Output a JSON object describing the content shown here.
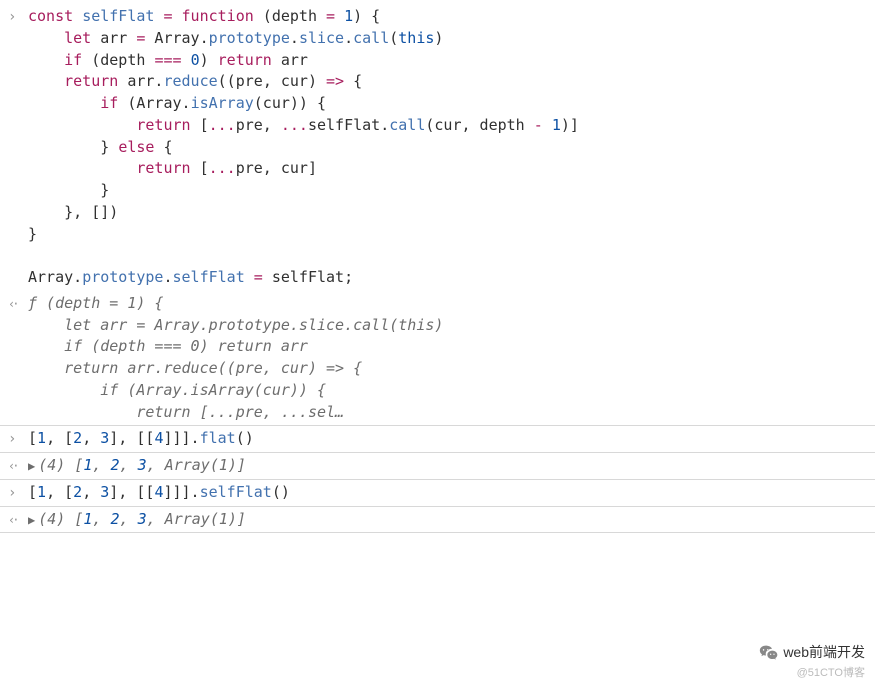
{
  "entries": [
    {
      "type": "input",
      "bordered": false,
      "html": "<span class='kw'>const</span> <span class='fn'>selfFlat</span> <span class='op'>=</span> <span class='kw'>function</span> (<span class='plain'>depth</span> <span class='op'>=</span> <span class='num'>1</span>) {\n    <span class='kw'>let</span> arr <span class='op'>=</span> Array.<span class='prop'>prototype</span>.<span class='prop'>slice</span>.<span class='fn'>call</span>(<span class='this'>this</span>)\n    <span class='kw'>if</span> (depth <span class='op'>===</span> <span class='num'>0</span>) <span class='kw'>return</span> arr\n    <span class='kw'>return</span> arr.<span class='fn'>reduce</span>((<span class='plain'>pre</span>, <span class='plain'>cur</span>) <span class='op'>=&gt;</span> {\n        <span class='kw'>if</span> (Array.<span class='fn'>isArray</span>(cur)) {\n            <span class='kw'>return</span> [<span class='op'>...</span>pre, <span class='op'>...</span>selfFlat.<span class='fn'>call</span>(cur, depth <span class='op'>-</span> <span class='num'>1</span>)]\n        } <span class='kw'>else</span> {\n            <span class='kw'>return</span> [<span class='op'>...</span>pre, cur]\n        }\n    }, [])\n}\n\nArray.<span class='prop'>prototype</span>.<span class='prop'>selfFlat</span> <span class='op'>=</span> selfFlat;"
    },
    {
      "type": "output",
      "bordered": true,
      "italic": true,
      "gray": true,
      "html": "ƒ (depth = 1) {\n    let arr = Array.prototype.slice.call(this)\n    if (depth === 0) return arr\n    return arr.reduce((pre, cur) =&gt; {\n        if (Array.isArray(cur)) {\n            return [...pre, ...sel…"
    },
    {
      "type": "input",
      "bordered": true,
      "html": "[<span class='num'>1</span>, [<span class='num'>2</span>, <span class='num'>3</span>], [[<span class='num'>4</span>]]].<span class='fn'>flat</span>()"
    },
    {
      "type": "output",
      "bordered": true,
      "italic": true,
      "expandable": true,
      "html": "<span class='gray'>(4)</span> <span class='gray'>[</span><span class='num'>1</span><span class='gray'>,</span> <span class='num'>2</span><span class='gray'>,</span> <span class='num'>3</span><span class='gray'>,</span> <span class='gray'>Array(1)]</span>"
    },
    {
      "type": "input",
      "bordered": true,
      "html": "[<span class='num'>1</span>, [<span class='num'>2</span>, <span class='num'>3</span>], [[<span class='num'>4</span>]]].<span class='fn'>selfFlat</span>()"
    },
    {
      "type": "output",
      "bordered": true,
      "italic": true,
      "expandable": true,
      "html": "<span class='gray'>(4)</span> <span class='gray'>[</span><span class='num'>1</span><span class='gray'>,</span> <span class='num'>2</span><span class='gray'>,</span> <span class='num'>3</span><span class='gray'>,</span> <span class='gray'>Array(1)]</span>"
    }
  ],
  "watermark": {
    "main": "web前端开发",
    "sub": "@51CTO博客"
  },
  "chart_data": null
}
